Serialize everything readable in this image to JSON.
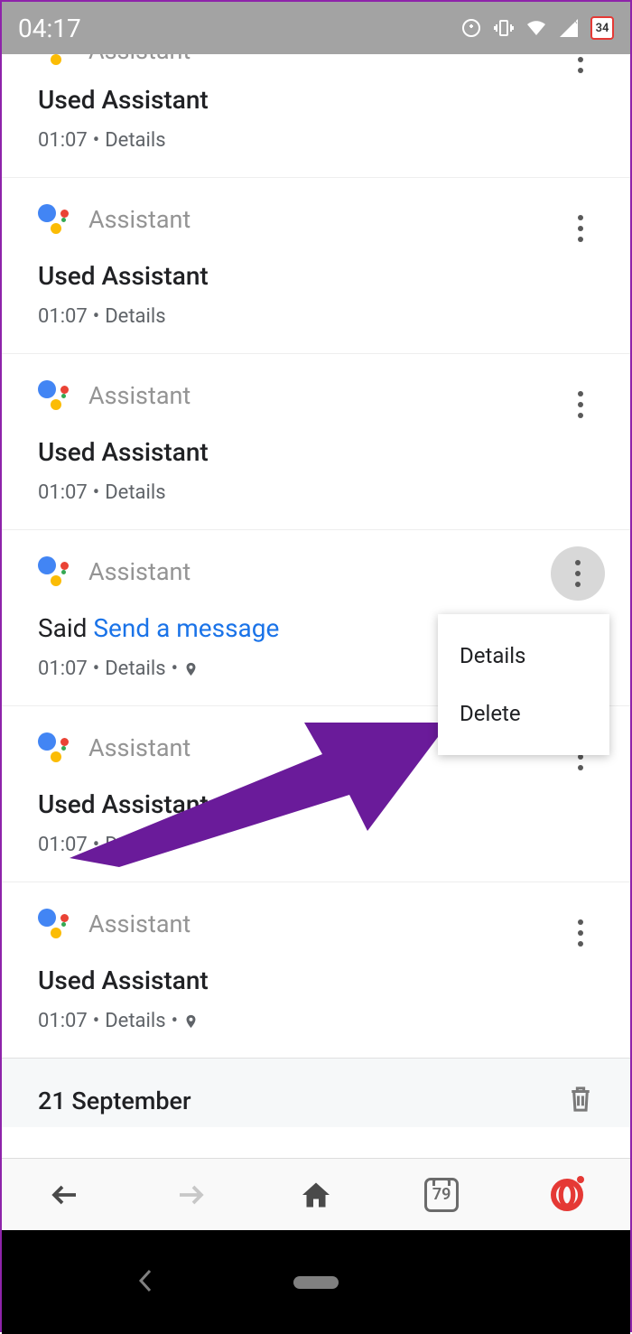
{
  "statusBar": {
    "time": "04:17",
    "batteryValue": "34"
  },
  "activities": [
    {
      "app": "Assistant",
      "title": "Used Assistant",
      "time": "01:07",
      "details": "Details",
      "hasLocation": false,
      "isSaid": false,
      "partial": true
    },
    {
      "app": "Assistant",
      "title": "Used Assistant",
      "time": "01:07",
      "details": "Details",
      "hasLocation": false,
      "isSaid": false
    },
    {
      "app": "Assistant",
      "title": "Used Assistant",
      "time": "01:07",
      "details": "Details",
      "hasLocation": false,
      "isSaid": false
    },
    {
      "app": "Assistant",
      "saidPrefix": "Said ",
      "saidLink": "Send a message",
      "time": "01:07",
      "details": "Details",
      "hasLocation": true,
      "isSaid": true,
      "menuOpen": true
    },
    {
      "app": "Assistant",
      "title": "Used Assistant",
      "time": "01:07",
      "details": "Details",
      "hasLocation": false,
      "isSaid": false
    },
    {
      "app": "Assistant",
      "title": "Used Assistant",
      "time": "01:07",
      "details": "Details",
      "hasLocation": true,
      "isSaid": false
    }
  ],
  "popup": {
    "items": [
      "Details",
      "Delete"
    ]
  },
  "dateSection": {
    "label": "21 September"
  },
  "bottomNav": {
    "tabCount": "79"
  }
}
